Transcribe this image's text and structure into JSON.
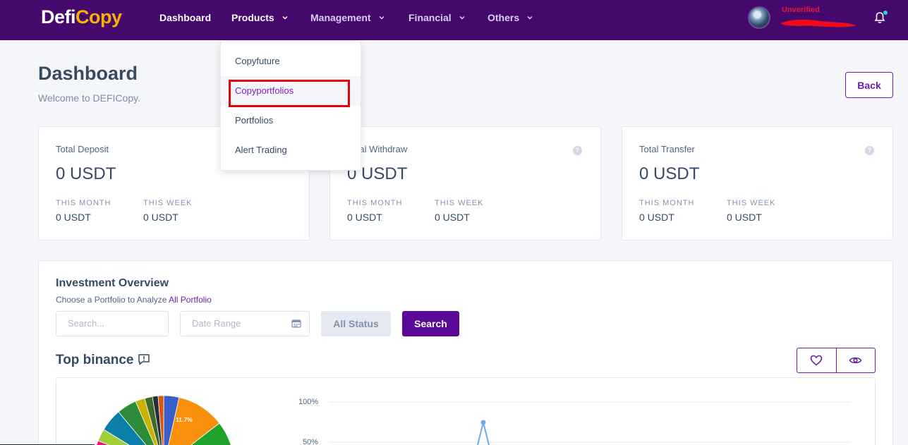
{
  "brand": {
    "part1": "Defi",
    "part2": "Copy"
  },
  "nav": {
    "dashboard": "Dashboard",
    "products": "Products",
    "management": "Management",
    "financial": "Financial",
    "others": "Others"
  },
  "user": {
    "status": "Unverified"
  },
  "products_menu": {
    "items": [
      "Copyfuture",
      "Copyportfolios",
      "Portfolios",
      "Alert Trading"
    ],
    "active": "Copyportfolios"
  },
  "page": {
    "title": "Dashboard",
    "subtitle": "Welcome to DEFICopy.",
    "back_label": "Back"
  },
  "stats": [
    {
      "title": "Total Deposit",
      "value": "0 USDT",
      "month_label": "THIS MONTH",
      "month_value": "0 USDT",
      "week_label": "THIS WEEK",
      "week_value": "0 USDT"
    },
    {
      "title": "Total Withdraw",
      "value": "0 USDT",
      "month_label": "THIS MONTH",
      "month_value": "0 USDT",
      "week_label": "THIS WEEK",
      "week_value": "0 USDT"
    },
    {
      "title": "Total Transfer",
      "value": "0 USDT",
      "month_label": "THIS MONTH",
      "month_value": "0 USDT",
      "week_label": "THIS WEEK",
      "week_value": "0 USDT"
    }
  ],
  "investment": {
    "title": "Investment Overview",
    "subtitle": "Choose a Portfolio to Analyze",
    "subtitle_link": "All Portfolio",
    "search_placeholder": "Search...",
    "date_placeholder": "Date Range",
    "status_label": "All Status",
    "search_label": "Search"
  },
  "chart_section": {
    "title": "Top binance",
    "pie_label": "11.7%",
    "y_ticks": [
      "100%",
      "50%"
    ]
  },
  "colors": {
    "nav_bg": "#45096e",
    "accent": "#6b1fa8",
    "search_btn": "#5a0a96",
    "logo_yellow": "#f6b400",
    "danger": "#e8143a"
  }
}
